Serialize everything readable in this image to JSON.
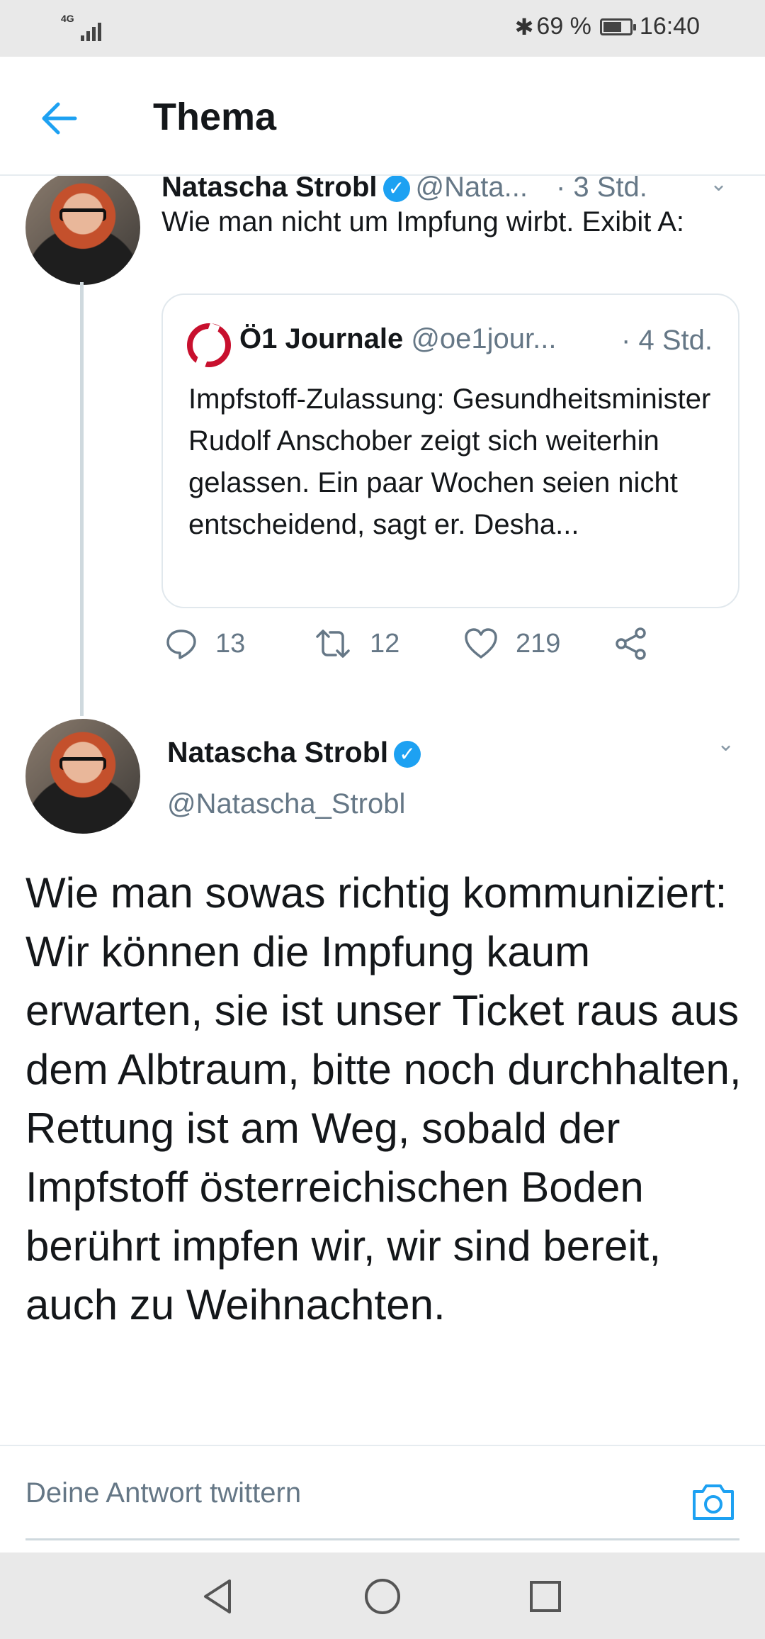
{
  "status_bar": {
    "network": "4G",
    "battery_text": "69 %",
    "battery_level": 0.69,
    "time": "16:40"
  },
  "header": {
    "title": "Thema"
  },
  "tweet1": {
    "name": "Natascha Strobl",
    "handle": "@Nata...",
    "time": "· 3 Std.",
    "text": "Wie man nicht um Impfung wirbt. Exibit A:",
    "quote": {
      "name": "Ö1 Journale",
      "handle": "@oe1jour...",
      "time": "· 4 Std.",
      "text": "Impfstoff-Zulassung: Gesundheitsminister Rudolf Anschober zeigt sich weiterhin gelassen. Ein paar Wochen seien nicht entscheidend, sagt er. Desha..."
    },
    "actions": {
      "replies": "13",
      "retweets": "12",
      "likes": "219"
    }
  },
  "main_tweet": {
    "name": "Natascha Strobl",
    "handle": "@Natascha_Strobl",
    "text": "Wie man sowas richtig kommuniziert:\nWir können die Impfung kaum erwarten, sie ist unser Ticket raus aus dem Albtraum, bitte noch durchhalten, Rettung ist am Weg, sobald der Impfstoff österreichischen Boden berührt impfen wir, wir sind bereit, auch zu Weihnachten."
  },
  "reply_bar": {
    "placeholder": "Deine Antwort twittern"
  },
  "colors": {
    "accent": "#1da1f2",
    "secondary_text": "#657786",
    "quote_logo": "#c8102e"
  }
}
